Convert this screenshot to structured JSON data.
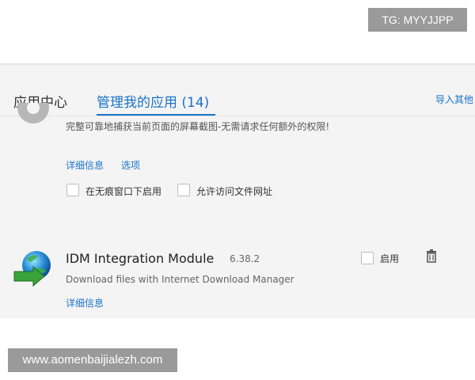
{
  "watermarks": {
    "top": "TG: MYYJJPP",
    "bottom": "www.aomenbaijialezh.com"
  },
  "tabs": [
    {
      "label": "应用中心"
    },
    {
      "label": "管理我的应用 (14)"
    }
  ],
  "import_link": "导入其他",
  "extension1": {
    "description": "完整可靠地捕获当前页面的屏幕截图-无需请求任何额外的权限!",
    "links": {
      "details": "详细信息",
      "options": "选项"
    },
    "checkboxes": {
      "incognito": "在无痕窗口下启用",
      "file_url": "允许访问文件网址"
    }
  },
  "extension2": {
    "name": "IDM Integration Module",
    "version": "6.38.2",
    "enable_label": "启用",
    "description": "Download files with Internet Download Manager",
    "details_link": "详细信息"
  },
  "colors": {
    "accent": "#1a73c8",
    "panel_bg": "#f4f4f4"
  },
  "icons": {
    "trash": "trash-icon",
    "idm": "idm-globe-arrow-icon"
  }
}
